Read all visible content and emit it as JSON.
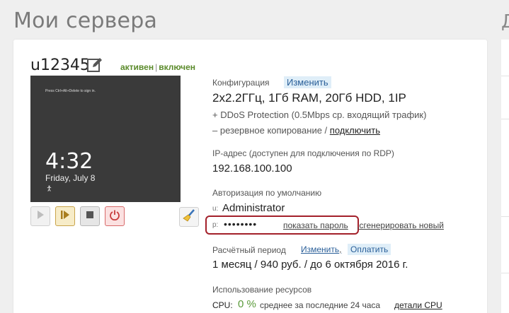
{
  "page": {
    "title": "Мои сервера",
    "side_title": "Д"
  },
  "server": {
    "name": "u12345",
    "status_active": "активен",
    "status_separator": "|",
    "status_power": "включен",
    "screen": {
      "hint": "Press Ctrl+Alt+Delete to sign in.",
      "time": "4:32",
      "date": "Friday, July 8",
      "access_icon": "ease-of-access-icon"
    }
  },
  "controls": {
    "icons": [
      "play-icon",
      "pause-icon",
      "stop-icon",
      "power-icon",
      "broom-icon"
    ]
  },
  "config": {
    "label": "Конфигурация",
    "change": "Изменить",
    "value": "2x2.2ГГц, 1Гб RAM, 20Гб HDD, 1IP",
    "ddos": "+ DDoS Protection (0.5Mbps ср. входящий трафик)",
    "backup_text": "– резервное копирование / ",
    "backup_link": "подключить"
  },
  "ip": {
    "label": "IP-адрес (доступен для подключения по RDP)",
    "value": "192.168.100.100"
  },
  "auth": {
    "label": "Авторизация по умолчанию",
    "user_prefix": "u:",
    "user": "Administrator",
    "pwd_prefix": "p:",
    "pwd_mask": "••••••••",
    "show": "показать пароль",
    "sep": ",",
    "generate": "сгенерировать новый"
  },
  "billing": {
    "label": "Расчётный период",
    "change": "Изменить",
    "sep": ",",
    "pay": "Оплатить",
    "value": "1 месяц / 940 руб. / до 6 октября 2016 г."
  },
  "resources": {
    "label": "Использование ресурсов",
    "cpu_label": "CPU:",
    "cpu_value": "0 %",
    "cpu_note": "среднее за последние 24 часа",
    "cpu_details": "детали CPU"
  }
}
